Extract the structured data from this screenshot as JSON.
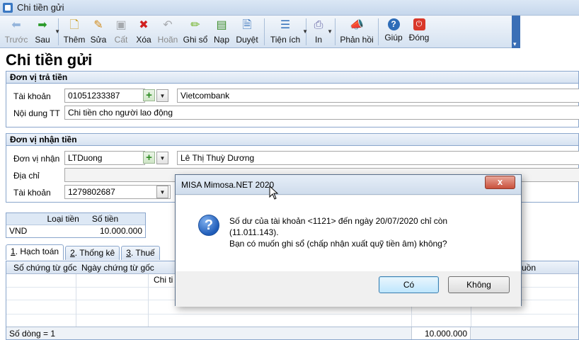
{
  "window": {
    "title": "Chi tiền gửi"
  },
  "toolbar": {
    "items": [
      {
        "label": "Trước",
        "icon": "arrow-left-icon",
        "disabled": true
      },
      {
        "label": "Sau",
        "icon": "arrow-right-icon",
        "disabled": false
      },
      {
        "label": "Thêm",
        "icon": "add-document-icon",
        "disabled": false
      },
      {
        "label": "Sửa",
        "icon": "edit-icon",
        "disabled": false
      },
      {
        "label": "Cất",
        "icon": "save-icon",
        "disabled": true
      },
      {
        "label": "Xóa",
        "icon": "delete-icon",
        "disabled": false
      },
      {
        "label": "Hoãn",
        "icon": "undo-icon",
        "disabled": true
      },
      {
        "label": "Ghi sổ",
        "icon": "pencil-icon",
        "disabled": false
      },
      {
        "label": "Nạp",
        "icon": "load-icon",
        "disabled": false
      },
      {
        "label": "Duyệt",
        "icon": "document-icon",
        "disabled": false
      },
      {
        "label": "Tiện ích",
        "icon": "utilities-icon",
        "disabled": false
      },
      {
        "label": "In",
        "icon": "print-icon",
        "disabled": false
      },
      {
        "label": "Phản hồi",
        "icon": "megaphone-icon",
        "disabled": false
      },
      {
        "label": "Giúp",
        "icon": "help-icon",
        "disabled": false
      },
      {
        "label": "Đóng",
        "icon": "power-icon",
        "disabled": false
      }
    ]
  },
  "page": {
    "title": "Chi tiền gửi"
  },
  "payer": {
    "header": "Đơn vị trả tiền",
    "account_label": "Tài khoản",
    "account_value": "01051233387",
    "bank_name": "Vietcombank",
    "content_label": "Nội dung TT",
    "content_value": "Chi tiền cho người lao động"
  },
  "payee": {
    "header": "Đơn vị nhận tiền",
    "unit_label": "Đơn vị nhận",
    "unit_code": "LTDuong",
    "unit_name": "Lê Thị Thuỳ Dương",
    "address_label": "Địa chỉ",
    "address_value": "",
    "account_label": "Tài khoản",
    "account_value": "1279802687"
  },
  "money": {
    "col_currency": "Loại tiền",
    "col_amount": "Số tiền",
    "currency": "VND",
    "amount": "10.000.000"
  },
  "tabs": [
    {
      "num": "1",
      "label": ". Hạch toán",
      "active": true
    },
    {
      "num": "2",
      "label": ". Thống kê",
      "active": false
    },
    {
      "num": "3",
      "label": ". Thuế",
      "active": false
    }
  ],
  "grid": {
    "col_doc_no": "Số chứng từ gốc",
    "col_doc_date": "Ngày chứng từ gốc",
    "col_detail_partial": "Chi ti",
    "col_right_partial": "uồn",
    "row_count": "Số dòng = 1",
    "total": "10.000.000"
  },
  "dialog": {
    "title": "MISA Mimosa.NET 2020",
    "close": "x",
    "line1": "Số dư của tài khoản <1121> đến ngày 20/07/2020  chỉ còn",
    "line2": "(11.011.143).",
    "line3": "Bạn có muốn ghi sổ (chấp nhận xuất quỹ tiền âm) không?",
    "yes": "Có",
    "no": "Không"
  }
}
